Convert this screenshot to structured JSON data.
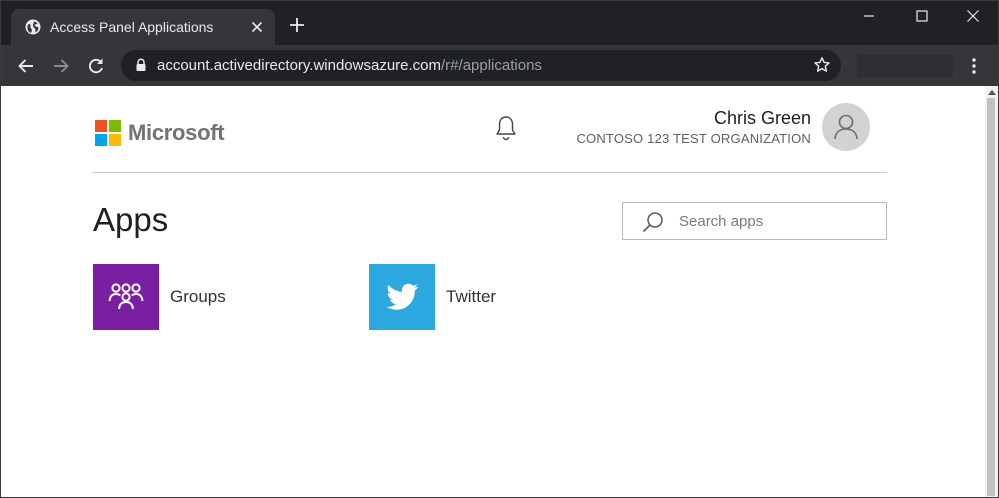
{
  "browser": {
    "tab_title": "Access Panel Applications",
    "url_host": "account.activedirectory.windowsazure.com",
    "url_path": "/r#/applications"
  },
  "header": {
    "brand": "Microsoft",
    "user_name": "Chris Green",
    "organization": "CONTOSO 123 TEST ORGANIZATION"
  },
  "main": {
    "heading": "Apps",
    "search_placeholder": "Search apps",
    "apps": [
      {
        "label": "Groups",
        "color": "#7b1fa2"
      },
      {
        "label": "Twitter",
        "color": "#2ca8e1"
      }
    ]
  },
  "colors": {
    "ms_red": "#f25022",
    "ms_green": "#7fba00",
    "ms_blue": "#00a4ef",
    "ms_yellow": "#ffb900"
  }
}
